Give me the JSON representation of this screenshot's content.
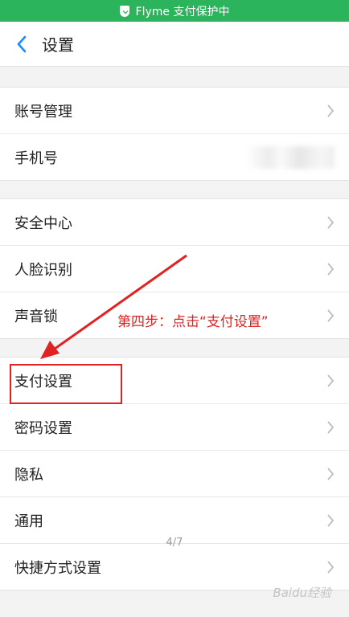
{
  "status_bar": {
    "text": "Flyme 支付保护中",
    "color": "#2bb45c"
  },
  "header": {
    "title": "设置"
  },
  "groups": [
    {
      "items": [
        {
          "label": "账号管理"
        },
        {
          "label": "手机号"
        }
      ]
    },
    {
      "items": [
        {
          "label": "安全中心"
        },
        {
          "label": "人脸识别"
        },
        {
          "label": "声音锁"
        }
      ]
    },
    {
      "items": [
        {
          "label": "支付设置"
        },
        {
          "label": "密码设置"
        },
        {
          "label": "隐私"
        },
        {
          "label": "通用"
        },
        {
          "label": "快捷方式设置"
        }
      ]
    }
  ],
  "page_indicator": "4/7",
  "annotation": {
    "text": "第四步：点击“支付设置”",
    "color": "#e02222"
  },
  "watermark": "Baidu经验"
}
